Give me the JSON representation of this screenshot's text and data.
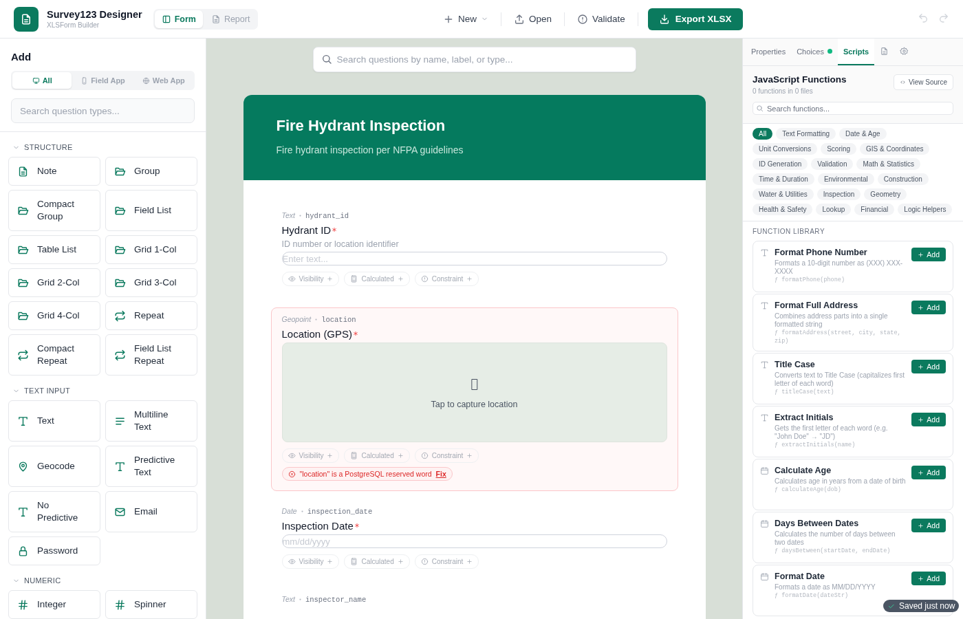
{
  "app": {
    "title": "Survey123 Designer",
    "subtitle": "XLSForm Builder"
  },
  "view_tabs": [
    {
      "label": "Form",
      "kind": "form",
      "selected": true
    },
    {
      "label": "Report",
      "kind": "report",
      "selected": false
    }
  ],
  "toolbar": [
    {
      "label": "New",
      "kind": "new"
    },
    {
      "label": "Open",
      "kind": "open"
    },
    {
      "label": "Validate",
      "kind": "validate"
    },
    {
      "label": "Export XLSX",
      "kind": "export"
    }
  ],
  "history": {
    "undo": {
      "disabled": true
    },
    "redo": {
      "disabled": true
    }
  },
  "palette": {
    "title": "Add",
    "platforms": [
      {
        "label": "All",
        "kind": "monitor",
        "selected": true
      },
      {
        "label": "Field App",
        "kind": "phone",
        "selected": false
      },
      {
        "label": "Web App",
        "kind": "globe",
        "selected": false
      }
    ],
    "search": {
      "placeholder": "Search question types..."
    },
    "sections": [
      {
        "title": "STRUCTURE",
        "expanded": true,
        "items": [
          {
            "label": "Note",
            "kind": "note"
          },
          {
            "label": "Group",
            "kind": "group"
          },
          {
            "label": "Compact Group",
            "kind": "group"
          },
          {
            "label": "Field List",
            "kind": "group"
          },
          {
            "label": "Table List",
            "kind": "group"
          },
          {
            "label": "Grid 1-Col",
            "kind": "group"
          },
          {
            "label": "Grid 2-Col",
            "kind": "group"
          },
          {
            "label": "Grid 3-Col",
            "kind": "group"
          },
          {
            "label": "Grid 4-Col",
            "kind": "group"
          },
          {
            "label": "Repeat",
            "kind": "repeat"
          },
          {
            "label": "Compact Repeat",
            "kind": "repeat"
          },
          {
            "label": "Field List Repeat",
            "kind": "repeat"
          }
        ]
      },
      {
        "title": "TEXT INPUT",
        "expanded": true,
        "items": [
          {
            "label": "Text",
            "kind": "text"
          },
          {
            "label": "Multiline Text",
            "kind": "multiline"
          },
          {
            "label": "Geocode",
            "kind": "geocode"
          },
          {
            "label": "Predictive Text",
            "kind": "text"
          },
          {
            "label": "No Predictive",
            "kind": "text"
          },
          {
            "label": "Email",
            "kind": "email"
          },
          {
            "label": "Password",
            "kind": "password"
          }
        ]
      },
      {
        "title": "NUMERIC",
        "expanded": true,
        "items": [
          {
            "label": "Integer",
            "kind": "number"
          },
          {
            "label": "Spinner",
            "kind": "number"
          }
        ]
      }
    ]
  },
  "canvas": {
    "search": {
      "placeholder": "Search questions by name, label, or type..."
    },
    "form": {
      "title": "Fire Hydrant Inspection",
      "description": "Fire hydrant inspection per NFPA guidelines"
    },
    "questions": [
      {
        "type": "Text",
        "name": "hydrant_id",
        "label": "Hydrant ID",
        "required": true,
        "hint": "ID number or location identifier",
        "kind": "text",
        "placeholder": "Enter text...",
        "rules": [
          {
            "label": "Visibility",
            "kind": "visibility"
          },
          {
            "label": "Calculated",
            "kind": "calculated"
          },
          {
            "label": "Constraint",
            "kind": "constraint"
          }
        ]
      },
      {
        "type": "Geopoint",
        "name": "location",
        "label": "Location (GPS)",
        "required": true,
        "kind": "geopoint",
        "capture": "Tap to capture location",
        "rules": [
          {
            "label": "Visibility",
            "kind": "visibility"
          },
          {
            "label": "Calculated",
            "kind": "calculated"
          },
          {
            "label": "Constraint",
            "kind": "constraint"
          }
        ],
        "error": {
          "message": "\"location\" is a PostgreSQL reserved word",
          "action": "Fix"
        }
      },
      {
        "type": "Date",
        "name": "inspection_date",
        "label": "Inspection Date",
        "required": true,
        "kind": "date",
        "placeholder": "mm/dd/yyyy",
        "rules": [
          {
            "label": "Visibility",
            "kind": "visibility"
          },
          {
            "label": "Calculated",
            "kind": "calculated"
          },
          {
            "label": "Constraint",
            "kind": "constraint"
          }
        ]
      },
      {
        "type": "Text",
        "name": "inspector_name",
        "kind": "text"
      }
    ]
  },
  "inspector": {
    "tabs": [
      {
        "label": "Properties",
        "kind": "text",
        "selected": false,
        "indicator": false
      },
      {
        "label": "Choices",
        "kind": "text",
        "selected": false,
        "indicator": true
      },
      {
        "label": "Scripts",
        "kind": "text",
        "selected": true,
        "indicator": false
      },
      {
        "kind": "file",
        "selected": false
      },
      {
        "kind": "settings",
        "selected": false
      }
    ],
    "scripts": {
      "title": "JavaScript Functions",
      "summary": "0 functions in 0 files",
      "view_source": "View Source",
      "search": {
        "placeholder": "Search functions..."
      },
      "categories": [
        {
          "label": "All",
          "selected": true
        },
        {
          "label": "Text Formatting",
          "selected": false
        },
        {
          "label": "Date & Age",
          "selected": false
        },
        {
          "label": "Unit Conversions",
          "selected": false
        },
        {
          "label": "Scoring",
          "selected": false
        },
        {
          "label": "GIS & Coordinates",
          "selected": false
        },
        {
          "label": "ID Generation",
          "selected": false
        },
        {
          "label": "Validation",
          "selected": false
        },
        {
          "label": "Math & Statistics",
          "selected": false
        },
        {
          "label": "Time & Duration",
          "selected": false
        },
        {
          "label": "Environmental",
          "selected": false
        },
        {
          "label": "Construction",
          "selected": false
        },
        {
          "label": "Water & Utilities",
          "selected": false
        },
        {
          "label": "Inspection",
          "selected": false
        },
        {
          "label": "Geometry",
          "selected": false
        },
        {
          "label": "Health & Safety",
          "selected": false
        },
        {
          "label": "Lookup",
          "selected": false
        },
        {
          "label": "Financial",
          "selected": false
        },
        {
          "label": "Logic Helpers",
          "selected": false
        }
      ],
      "library_title": "FUNCTION LIBRARY",
      "functions": [
        {
          "name": "Format Phone Number",
          "description": "Formats a 10-digit number as (XXX) XXX-XXXX",
          "signature": "ƒ formatPhone(phone)",
          "kind": "text",
          "action": "Add"
        },
        {
          "name": "Format Full Address",
          "description": "Combines address parts into a single formatted string",
          "signature": "ƒ formatAddress(street, city, state, zip)",
          "kind": "text",
          "action": "Add"
        },
        {
          "name": "Title Case",
          "description": "Converts text to Title Case (capitalizes first letter of each word)",
          "signature": "ƒ titleCase(text)",
          "kind": "text",
          "action": "Add"
        },
        {
          "name": "Extract Initials",
          "description": "Gets the first letter of each word (e.g. \"John Doe\" → \"JD\")",
          "signature": "ƒ extractInitials(name)",
          "kind": "text",
          "action": "Add"
        },
        {
          "name": "Calculate Age",
          "description": "Calculates age in years from a date of birth",
          "signature": "ƒ calculateAge(dob)",
          "kind": "date",
          "action": "Add"
        },
        {
          "name": "Days Between Dates",
          "description": "Calculates the number of days between two dates",
          "signature": "ƒ daysBetween(startDate, endDate)",
          "kind": "date",
          "action": "Add"
        },
        {
          "name": "Format Date",
          "description": "Formats a date as MM/DD/YYYY",
          "signature": "ƒ formatDate(dateStr)",
          "kind": "date",
          "action": "Add"
        }
      ]
    }
  },
  "toast": {
    "message": "Saved just now"
  }
}
